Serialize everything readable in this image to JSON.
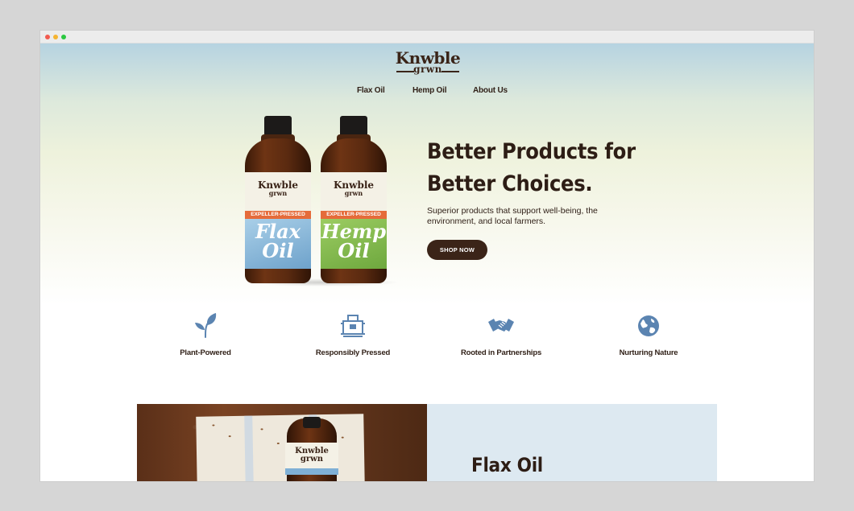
{
  "brand": {
    "logo_line1": "Knwble",
    "logo_line2": "grwn"
  },
  "nav": {
    "items": [
      "Flax Oil",
      "Hemp Oil",
      "About Us"
    ]
  },
  "hero": {
    "headline_line1": "Better Products for",
    "headline_line2": "Better Choices.",
    "subtext": "Superior products that support well-being, the environment, and local farmers.",
    "cta_label": "SHOP NOW",
    "bottles": [
      {
        "brand_line1": "Knwble",
        "brand_line2": "grwn",
        "band": "EXPELLER-PRESSED",
        "product_line1": "Flax",
        "product_line2": "Oil"
      },
      {
        "brand_line1": "Knwble",
        "brand_line2": "grwn",
        "band": "EXPELLER-PRESSED",
        "product_line1": "Hemp",
        "product_line2": "Oil"
      }
    ]
  },
  "features": [
    {
      "label": "Plant-Powered",
      "icon": "leaf-icon"
    },
    {
      "label": "Responsibly Pressed",
      "icon": "press-icon"
    },
    {
      "label": "Rooted in Partnerships",
      "icon": "handshake-icon"
    },
    {
      "label": "Nurturing Nature",
      "icon": "globe-icon"
    }
  ],
  "product_section": {
    "title": "Flax Oil",
    "photo_label_line1": "Knwble",
    "photo_label_line2": "grwn"
  },
  "colors": {
    "dark_brown": "#3b2418",
    "icon_blue": "#5b84b1",
    "flax_blue": "#7fb0d6",
    "hemp_green": "#7cb248",
    "panel_blue": "#dde9f1"
  }
}
